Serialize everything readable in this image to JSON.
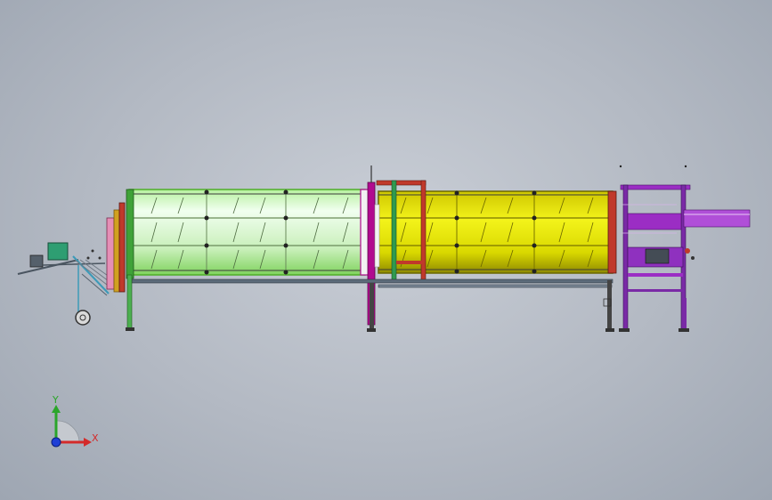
{
  "viewport": {
    "background_top": "#c9ced6",
    "background_bottom": "#9ea6b2"
  },
  "model": {
    "drum_left_color": "#d8f7c9",
    "drum_left_edge_color": "#6fcf3f",
    "drum_right_color": "#e3e400",
    "drum_right_edge_color": "#8d8b00",
    "frame_color": "#7a2aa6",
    "rail_color": "#5c6b7a",
    "accent_magenta": "#b10a8f",
    "accent_red": "#c0392b",
    "motor_color": "#2e9e72"
  },
  "triad": {
    "y_label": "Y",
    "x_label": "X",
    "y_color": "#2aa52a",
    "x_color": "#d42a2a",
    "z_color": "#1f3fd6"
  }
}
